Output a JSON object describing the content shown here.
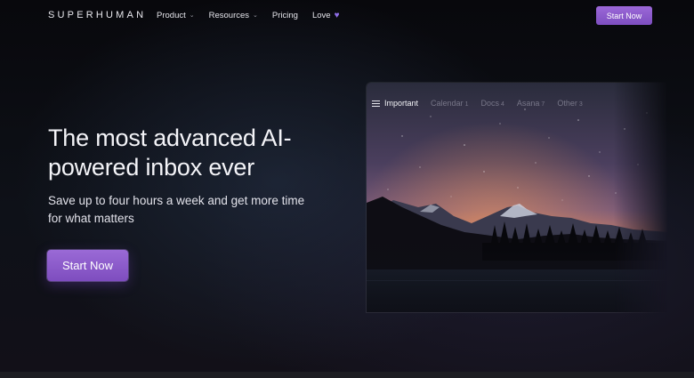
{
  "brand": {
    "logo": "SUPERHUMAN"
  },
  "nav": {
    "items": [
      {
        "label": "Product",
        "has_dropdown": true
      },
      {
        "label": "Resources",
        "has_dropdown": true
      },
      {
        "label": "Pricing",
        "has_dropdown": false
      },
      {
        "label": "Love",
        "icon": "purple-heart-icon"
      }
    ],
    "cta_label": "Start Now"
  },
  "hero": {
    "headline": "The most advanced AI-powered inbox ever",
    "subhead": "Save up to four hours a week and get more time for what matters",
    "cta_label": "Start Now"
  },
  "preview": {
    "tabs": [
      {
        "label": "Important",
        "count": "",
        "active": true
      },
      {
        "label": "Calendar",
        "count": "1",
        "active": false
      },
      {
        "label": "Docs",
        "count": "4",
        "active": false
      },
      {
        "label": "Asana",
        "count": "7",
        "active": false
      },
      {
        "label": "Other",
        "count": "3",
        "active": false
      }
    ]
  },
  "colors": {
    "background": "#0a0b10",
    "accent": "#8b5cd0",
    "heart": "#8f6ee8"
  }
}
